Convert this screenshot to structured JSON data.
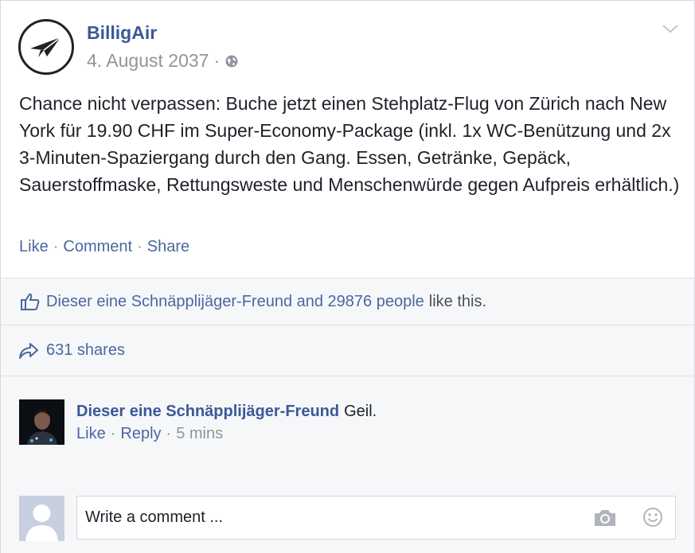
{
  "post": {
    "page_name": "BilligAir",
    "date": "4. August 2037",
    "separator": "·",
    "text": "Chance nicht verpassen: Buche jetzt einen Stehplatz-Flug von Zürich nach New York für 19.90 CHF im Super-Economy-Package (inkl. 1x WC-Benützung und 2x 3-Minuten-Spaziergang durch den Gang. Essen, Getränke, Gepäck, Sauerstoffmaske, Rettungsweste und Menschenwürde gegen Aufpreis erhältlich.)",
    "actions": {
      "like": "Like",
      "comment": "Comment",
      "share": "Share",
      "sep": "·"
    }
  },
  "reactions": {
    "likes_link": "Dieser eine Schnäpplijäger-Freund and 29876 people",
    "likes_tail": "like this.",
    "shares": "631 shares"
  },
  "comment": {
    "author": "Dieser eine Schnäpplijäger-Freund",
    "text": "Geil.",
    "like": "Like",
    "reply": "Reply",
    "time": "5 mins",
    "sep": "·"
  },
  "composer": {
    "placeholder": "Write a comment ..."
  },
  "colors": {
    "link": "#3b5998",
    "muted": "#90949c",
    "text": "#1d2129",
    "panel": "#f6f7f9"
  },
  "icons": [
    "paper-plane-logo-icon",
    "globe-icon",
    "chevron-down-icon",
    "thumbs-up-icon",
    "share-arrow-icon",
    "camera-icon",
    "smiley-icon"
  ]
}
